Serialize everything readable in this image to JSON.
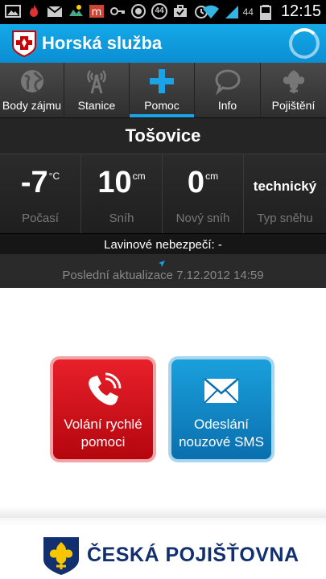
{
  "status_bar": {
    "notification_icons": [
      "photo-icon",
      "flame-icon",
      "gmail-icon",
      "weather-icon",
      "app-icon",
      "key-icon",
      "vpn-icon",
      "badge-icon",
      "briefcase-icon",
      "alarm-icon",
      "wifi-icon",
      "signal-icon",
      "battery-icon"
    ],
    "badge_count": "44",
    "battery_level": "44",
    "time": "12:15"
  },
  "app_bar": {
    "title": "Horská služba",
    "accent_color": "#0b8ed3"
  },
  "tabs": [
    {
      "label": "Body zájmu",
      "icon": "globe-icon",
      "active": false
    },
    {
      "label": "Stanice",
      "icon": "antenna-icon",
      "active": false
    },
    {
      "label": "Pomoc",
      "icon": "plus-icon",
      "active": true
    },
    {
      "label": "Info",
      "icon": "speech-bubble-icon",
      "active": false
    },
    {
      "label": "Pojištění",
      "icon": "shield-icon",
      "active": false
    }
  ],
  "station": {
    "name": "Tošovice"
  },
  "stats": [
    {
      "value": "-7",
      "unit": "°C",
      "label": "Počasí"
    },
    {
      "value": "10",
      "unit": "cm",
      "label": "Sníh"
    },
    {
      "value": "0",
      "unit": "cm",
      "label": "Nový sníh"
    },
    {
      "value": "technický",
      "unit": "",
      "label": "Typ sněhu"
    }
  ],
  "avalanche": {
    "text": "Lavinové nebezpečí: -"
  },
  "update": {
    "text": "Poslední aktualizace 7.12.2012 14:59"
  },
  "actions": {
    "call_line1": "Volání rychlé",
    "call_line2": "pomoci",
    "sms_line1": "Odeslání",
    "sms_line2": "nouzové SMS",
    "call_color": "#d10f18",
    "sms_color": "#1590cf"
  },
  "footer": {
    "brand": "ČESKÁ POJIŠŤOVNA",
    "brand_color": "#12306f"
  }
}
